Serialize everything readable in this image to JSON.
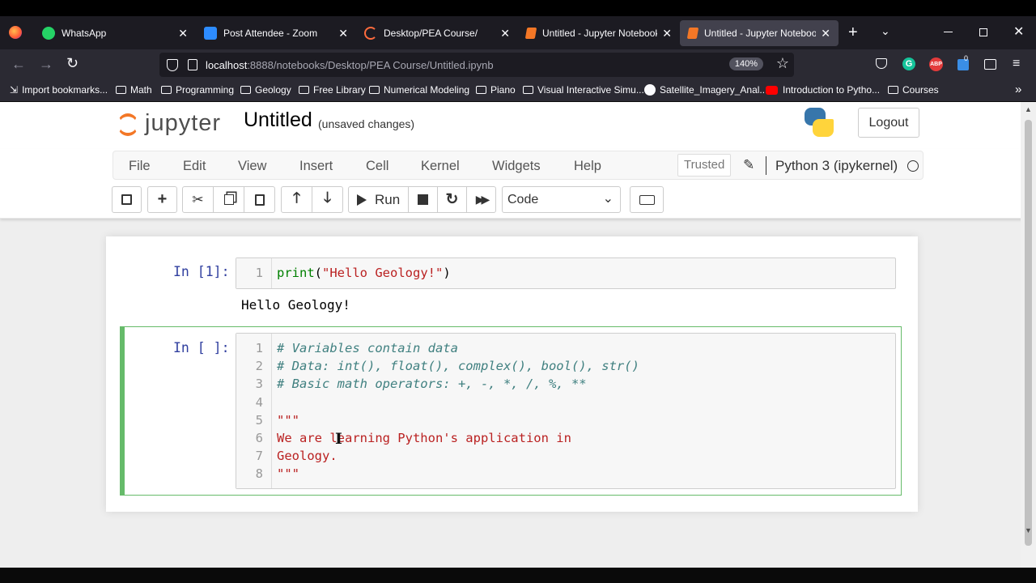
{
  "browser": {
    "tabs": [
      {
        "label": "WhatsApp",
        "active": false
      },
      {
        "label": "Post Attendee - Zoom",
        "active": false
      },
      {
        "label": "Desktop/PEA Course/",
        "active": false
      },
      {
        "label": "Untitled - Jupyter Notebook",
        "active": false
      },
      {
        "label": "Untitled - Jupyter Notebook",
        "active": true
      }
    ],
    "url_host": "localhost",
    "url_rest": ":8888/notebooks/Desktop/PEA Course/Untitled.ipynb",
    "zoom": "140%",
    "bookmarks": [
      {
        "label": "Import bookmarks..."
      },
      {
        "label": "Math"
      },
      {
        "label": "Programming"
      },
      {
        "label": "Geology"
      },
      {
        "label": "Free Library"
      },
      {
        "label": "Numerical Modeling"
      },
      {
        "label": "Piano"
      },
      {
        "label": "Visual Interactive Simu..."
      },
      {
        "label": "Satellite_Imagery_Anal..."
      },
      {
        "label": "Introduction to Pytho..."
      },
      {
        "label": "Courses"
      }
    ],
    "ext_badge": "0"
  },
  "jupyter": {
    "logo_text": "jupyter",
    "notebook_name": "Untitled",
    "save_status": "(unsaved changes)",
    "logout_label": "Logout",
    "menu": [
      "File",
      "Edit",
      "View",
      "Insert",
      "Cell",
      "Kernel",
      "Widgets",
      "Help"
    ],
    "trusted_label": "Trusted",
    "kernel_name": "Python 3 (ipykernel)",
    "run_label": "Run",
    "cell_type": "Code"
  },
  "cells": [
    {
      "prompt": "In [1]:",
      "line_numbers": [
        "1"
      ],
      "code_fn": "print",
      "code_open": "(",
      "code_str": "\"Hello Geology!\"",
      "code_close": ")",
      "output": "Hello Geology!"
    },
    {
      "prompt": "In [ ]:",
      "line_numbers": [
        "1",
        "2",
        "3",
        "4",
        "5",
        "6",
        "7",
        "8"
      ],
      "lines": [
        {
          "text": "# Variables contain data",
          "kind": "comment"
        },
        {
          "text": "# Data: int(), float(), complex(), bool(), str()",
          "kind": "comment"
        },
        {
          "text": "# Basic math operators: +, -, *, /, %, **",
          "kind": "comment"
        },
        {
          "text": "",
          "kind": "plain"
        },
        {
          "text": "\"\"\"",
          "kind": "string"
        },
        {
          "text": "We are learning Python's application in",
          "kind": "string"
        },
        {
          "text": "Geology.",
          "kind": "string"
        },
        {
          "text": "\"\"\"",
          "kind": "string"
        }
      ]
    }
  ],
  "colors": {
    "tab_bg": "#1c1b22",
    "toolbar_bg": "#2b2a33",
    "selected_cell_border": "#66bb6a",
    "comment": "#408080",
    "string": "#ba2121",
    "builtin": "#008000",
    "prompt": "#303f9f"
  }
}
